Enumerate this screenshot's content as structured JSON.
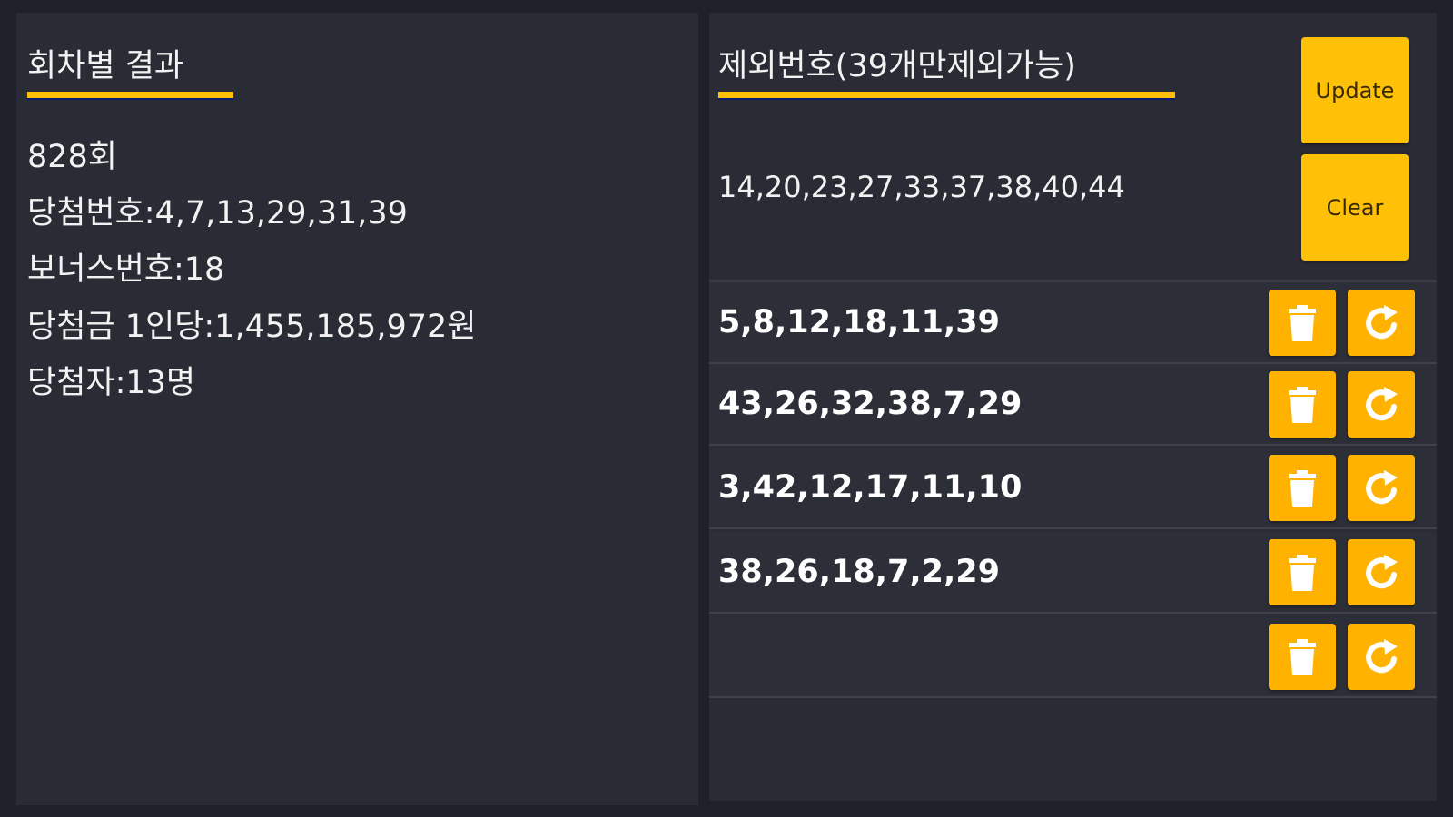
{
  "results": {
    "title": "회차별 결과",
    "lines": [
      "828회",
      "당첨번호:4,7,13,29,31,39",
      "보너스번호:18",
      "당첨금 1인당:1,455,185,972원",
      "당첨자:13명"
    ]
  },
  "exclusion": {
    "title": "제외번호(39개만제외가능)",
    "numbers": "14,20,23,27,33,37,38,40,44",
    "update_label": "Update",
    "clear_label": "Clear"
  },
  "rows": [
    {
      "numbers": "5,8,12,18,11,39"
    },
    {
      "numbers": "43,26,32,38,7,29"
    },
    {
      "numbers": "3,42,12,17,11,10"
    },
    {
      "numbers": "38,26,18,7,2,29"
    },
    {
      "numbers": ""
    }
  ],
  "icons": {
    "delete": "trash-icon",
    "regenerate": "refresh-icon"
  },
  "colors": {
    "accent": "#ffc107",
    "icon_button": "#ffb300",
    "background": "#1f2128",
    "panel": "#2a2c35",
    "text": "#f2f2f2",
    "underline_edge": "#0b1b6e"
  }
}
